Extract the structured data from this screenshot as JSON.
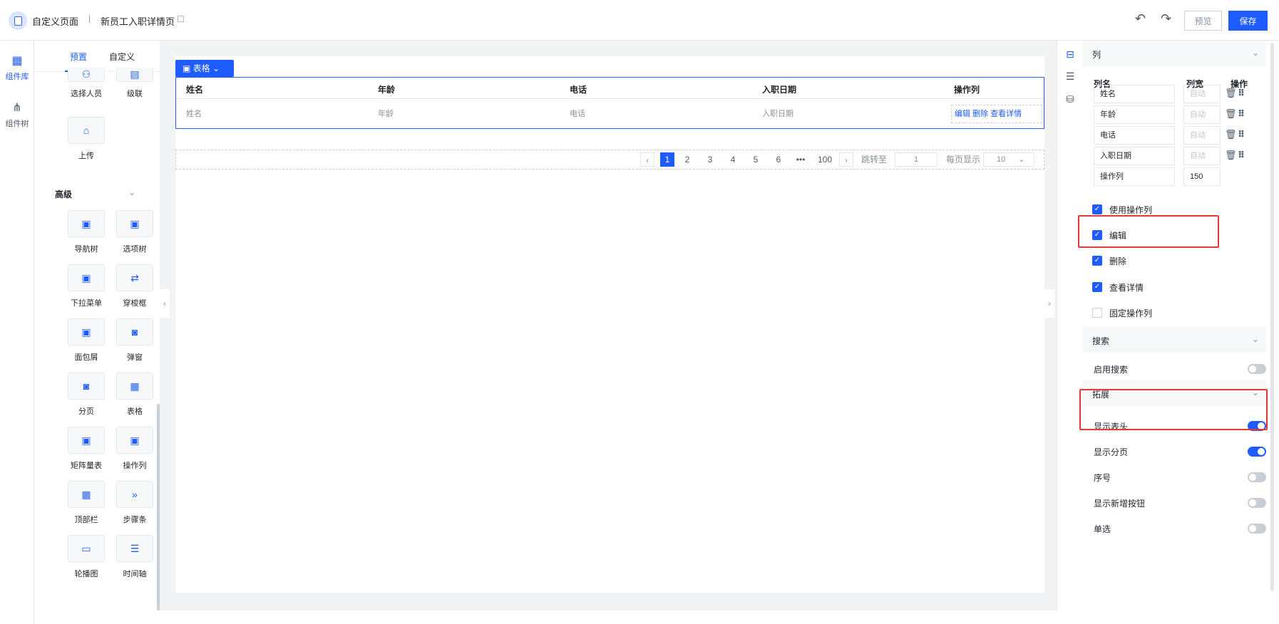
{
  "header": {
    "app_title": "自定义页面",
    "separator": "|",
    "page_name": "新员工入职详情页",
    "edit_icon": "edit-icon",
    "undo_icon": "undo-icon",
    "redo_icon": "redo-icon",
    "preview_label": "预览",
    "save_label": "保存"
  },
  "rail": {
    "items": [
      {
        "label": "组件库",
        "icon": "grid-icon",
        "active": true
      },
      {
        "label": "组件树",
        "icon": "tree-icon",
        "active": false
      }
    ]
  },
  "palette": {
    "tabs": [
      "预置",
      "自定义"
    ],
    "top_items": [
      {
        "label": "选择人员",
        "icon": "user-icon"
      },
      {
        "label": "级联",
        "icon": "cascade-icon"
      },
      {
        "label": "上传",
        "icon": "upload-icon"
      }
    ],
    "section_title": "高级",
    "advanced": [
      {
        "label": "导航树",
        "icon": "box-icon"
      },
      {
        "label": "选项树",
        "icon": "box-icon"
      },
      {
        "label": "下拉菜单",
        "icon": "box-icon"
      },
      {
        "label": "穿梭框",
        "icon": "transfer-icon"
      },
      {
        "label": "面包屑",
        "icon": "box-icon"
      },
      {
        "label": "弹窗",
        "icon": "dialog-icon"
      },
      {
        "label": "分页",
        "icon": "dialog-icon"
      },
      {
        "label": "表格",
        "icon": "table-icon"
      },
      {
        "label": "矩阵量表",
        "icon": "box-icon"
      },
      {
        "label": "操作列",
        "icon": "box-icon"
      },
      {
        "label": "顶部栏",
        "icon": "table-icon"
      },
      {
        "label": "步骤条",
        "icon": "steps-icon"
      },
      {
        "label": "轮播图",
        "icon": "carousel-icon"
      },
      {
        "label": "时间轴",
        "icon": "timeline-icon"
      }
    ]
  },
  "canvas": {
    "component_tag": "表格",
    "table": {
      "headers": [
        "姓名",
        "年龄",
        "电话",
        "入职日期",
        "操作列"
      ],
      "row": [
        "姓名",
        "年龄",
        "电话",
        "入职日期"
      ],
      "ops": "编辑 删除 查看详情"
    },
    "pagination": {
      "pages": [
        "1",
        "2",
        "3",
        "4",
        "5",
        "6",
        "•••",
        "100"
      ],
      "jump_label": "跳转至",
      "jump_value": "1",
      "size_label": "每页显示",
      "size_value": "10"
    }
  },
  "props": {
    "columns_section": "列",
    "col_headers": [
      "列名",
      "列宽",
      "操作"
    ],
    "columns": [
      {
        "name": "姓名",
        "width": "自动"
      },
      {
        "name": "年龄",
        "width": "自动"
      },
      {
        "name": "电话",
        "width": "自动"
      },
      {
        "name": "入职日期",
        "width": "自动"
      },
      {
        "name": "操作列",
        "width": "150"
      }
    ],
    "checks": [
      {
        "label": "使用操作列",
        "checked": true
      },
      {
        "label": "编辑",
        "checked": true
      },
      {
        "label": "删除",
        "checked": true
      },
      {
        "label": "查看详情",
        "checked": true
      },
      {
        "label": "固定操作列",
        "checked": false
      }
    ],
    "search_section": "搜索",
    "search_toggle": {
      "label": "启用搜索",
      "on": false
    },
    "extend_section": "拓展",
    "extend_toggles": [
      {
        "label": "显示表头",
        "on": true
      },
      {
        "label": "显示分页",
        "on": true
      },
      {
        "label": "序号",
        "on": false
      },
      {
        "label": "显示新增按钮",
        "on": false
      },
      {
        "label": "单选",
        "on": false
      }
    ]
  },
  "colors": {
    "accent": "#1f5cff",
    "highlight": "#e53935"
  }
}
